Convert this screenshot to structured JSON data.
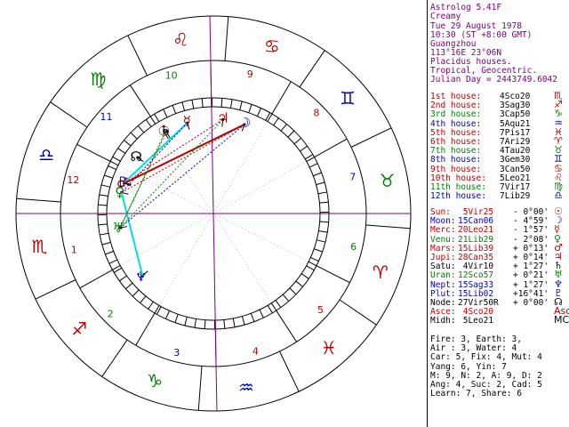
{
  "header": {
    "app_title": "Astrolog 5.41F",
    "name": "Creamy",
    "date": "Tue 29 August 1978",
    "time": "10:30 (ST +8:00 GMT)",
    "place": "Guangzhou",
    "coords": "113°16E 23°06N",
    "house_system": "Placidus houses.",
    "zodiac": "Tropical, Geocentric.",
    "julian": "Julian Day = 2443749.6042"
  },
  "houses": [
    {
      "label": "1st house:",
      "pos": "4Sco20",
      "glyph": "♏",
      "color": "#c00000"
    },
    {
      "label": "2nd house:",
      "pos": "3Sag30",
      "glyph": "♐",
      "color": "#c00000"
    },
    {
      "label": "3rd house:",
      "pos": "3Cap50",
      "glyph": "♑",
      "color": "#008000"
    },
    {
      "label": "4th house:",
      "pos": "5Aqu21",
      "glyph": "♒",
      "color": "#0000c0"
    },
    {
      "label": "5th house:",
      "pos": "7Pis17",
      "glyph": "♓",
      "color": "#c00000"
    },
    {
      "label": "6th house:",
      "pos": "7Ari29",
      "glyph": "♈",
      "color": "#c00000"
    },
    {
      "label": "7th house:",
      "pos": "4Tau20",
      "glyph": "♉",
      "color": "#008000"
    },
    {
      "label": "8th house:",
      "pos": "3Gem30",
      "glyph": "♊",
      "color": "#0000c0"
    },
    {
      "label": "9th house:",
      "pos": "3Can50",
      "glyph": "♋",
      "color": "#c00000"
    },
    {
      "label": "10th house:",
      "pos": "5Leo21",
      "glyph": "♌",
      "color": "#c00000"
    },
    {
      "label": "11th house:",
      "pos": "7Vir17",
      "glyph": "♍",
      "color": "#008000"
    },
    {
      "label": "12th house:",
      "pos": "7Lib29",
      "glyph": "♎",
      "color": "#0000c0"
    }
  ],
  "planets": [
    {
      "label": "Sun:",
      "pos": " 5Vir25",
      "motion": "- 0°00'",
      "glyph": "☉",
      "color": "#c00000"
    },
    {
      "label": "Moon:",
      "pos": "15Can06",
      "motion": "- 4°59'",
      "glyph": "☽",
      "color": "#0000c0"
    },
    {
      "label": "Merc:",
      "pos": "20Leo21",
      "motion": "- 1°57'",
      "glyph": "☿",
      "color": "#c00000"
    },
    {
      "label": "Venu:",
      "pos": "21Lib29",
      "motion": "- 2°08'",
      "glyph": "♀",
      "color": "#008000"
    },
    {
      "label": "Mars:",
      "pos": "15Lib39",
      "motion": "+ 0°13'",
      "glyph": "♂",
      "color": "#c00000"
    },
    {
      "label": "Jupi:",
      "pos": "28Can35",
      "motion": "+ 0°14'",
      "glyph": "♃",
      "color": "#c00000"
    },
    {
      "label": "Satu:",
      "pos": " 4Vir10",
      "motion": "+ 1°27'",
      "glyph": "♄",
      "color": "#000000"
    },
    {
      "label": "Uran:",
      "pos": "12Sco57",
      "motion": "+ 0°21'",
      "glyph": "♅",
      "color": "#008000"
    },
    {
      "label": "Nept:",
      "pos": "15Sag33",
      "motion": "+ 1°27'",
      "glyph": "♆",
      "color": "#0000c0"
    },
    {
      "label": "Plut:",
      "pos": "15Lib02",
      "motion": "+16°41'",
      "glyph": "♇",
      "color": "#0000c0"
    },
    {
      "label": "Node:",
      "pos": "27Vir50R",
      "motion": "+ 0°00'",
      "glyph": "☊",
      "color": "#000000"
    },
    {
      "label": "Asce:",
      "pos": " 4Sco20",
      "motion": "",
      "glyph": "Asc",
      "color": "#c00000"
    },
    {
      "label": "Midh:",
      "pos": " 5Leo21",
      "motion": "",
      "glyph": "MC",
      "color": "#000000"
    }
  ],
  "stats": [
    "Fire: 3, Earth: 3,",
    "Air : 3, Water: 4",
    "Car: 5, Fix: 4, Mut: 4",
    "Yang: 6, Yin: 7",
    "M: 9, N: 2, A: 9, D: 2",
    "Ang: 4, Suc: 2, Cad: 5",
    "Learn: 7, Share: 6"
  ],
  "colors": {
    "fire": "#c00000",
    "earth": "#008000",
    "air": "#0000c0",
    "water": "#c00000",
    "axis": "#800080",
    "cyan": "#00e0e0"
  },
  "wheel": {
    "ascendant_deg": 214.33,
    "house_numbers": [
      "1",
      "2",
      "3",
      "4",
      "5",
      "6",
      "7",
      "8",
      "9",
      "10",
      "11",
      "12"
    ],
    "sign_glyphs": [
      "♈",
      "♉",
      "♊",
      "♋",
      "♌",
      "♍",
      "♎",
      "♏",
      "♐",
      "♑",
      "♒",
      "♓"
    ],
    "house_cusps_deg": [
      214.33,
      243.5,
      273.83,
      305.35,
      337.28,
      7.48,
      34.33,
      63.5,
      93.83,
      125.35,
      157.28,
      187.48
    ],
    "planets": [
      {
        "name": "Sun",
        "glyph": "☉",
        "lon": 155.42,
        "color": "#c00000"
      },
      {
        "name": "Moon",
        "glyph": "☽",
        "lon": 105.1,
        "color": "#0000c0"
      },
      {
        "name": "Mercury",
        "glyph": "☿",
        "lon": 140.35,
        "color": "#c00000"
      },
      {
        "name": "Venus",
        "glyph": "♀",
        "lon": 201.48,
        "color": "#008000"
      },
      {
        "name": "Mars",
        "glyph": "♂",
        "lon": 195.65,
        "color": "#c00000"
      },
      {
        "name": "Jupiter",
        "glyph": "♃",
        "lon": 118.58,
        "color": "#c00000"
      },
      {
        "name": "Saturn",
        "glyph": "♄",
        "lon": 154.17,
        "color": "#000000"
      },
      {
        "name": "Uranus",
        "glyph": "♅",
        "lon": 222.95,
        "color": "#008000"
      },
      {
        "name": "Neptune",
        "glyph": "♆",
        "lon": 255.55,
        "color": "#0000c0"
      },
      {
        "name": "Pluto",
        "glyph": "♇",
        "lon": 195.03,
        "color": "#0000c0"
      },
      {
        "name": "Node",
        "glyph": "☊",
        "lon": 177.83,
        "color": "#000000"
      }
    ]
  }
}
